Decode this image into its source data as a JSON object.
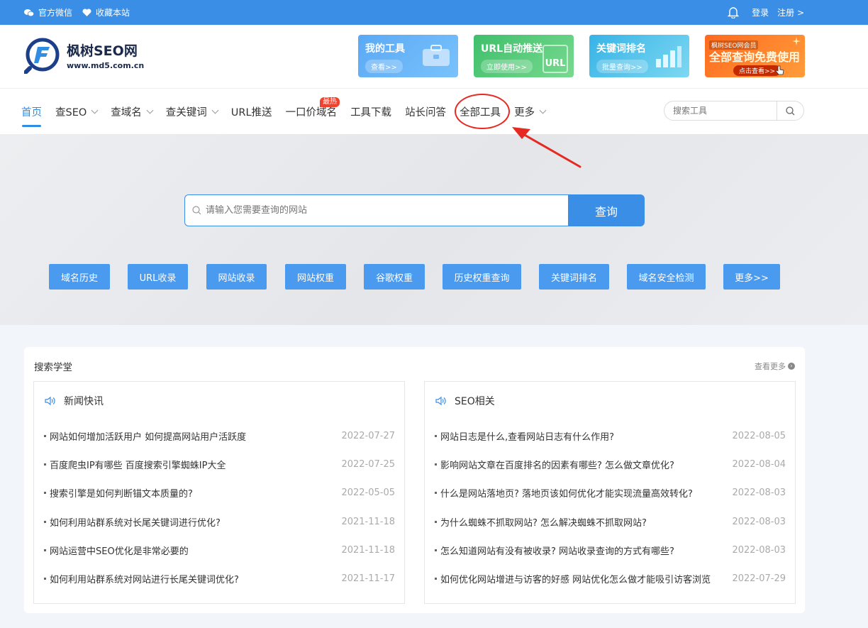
{
  "topbar": {
    "wechat": "官方微信",
    "favorite": "收藏本站",
    "login": "登录",
    "register": "注册 >"
  },
  "logo": {
    "title": "枫树SEO网",
    "url": "www.md5.com.cn"
  },
  "banners": [
    {
      "title": "我的工具",
      "button": "查看>>"
    },
    {
      "title": "URL自动推送",
      "button": "立即使用>>",
      "art": "URL"
    },
    {
      "title": "关键词排名",
      "button": "批量查询>>"
    },
    {
      "top": "枫树SEO网会员",
      "title": "全部查询免费使用",
      "button": "点击查看>>"
    }
  ],
  "nav": {
    "items": [
      {
        "label": "首页",
        "active": true
      },
      {
        "label": "查SEO",
        "dropdown": true
      },
      {
        "label": "查域名",
        "dropdown": true
      },
      {
        "label": "查关键词",
        "dropdown": true
      },
      {
        "label": "URL推送"
      },
      {
        "label": "一口价域名",
        "badge": "最热"
      },
      {
        "label": "工具下载"
      },
      {
        "label": "站长问答"
      },
      {
        "label": "全部工具",
        "highlighted": true
      },
      {
        "label": "更多",
        "dropdown": true
      }
    ],
    "search_placeholder": "搜索工具"
  },
  "hero": {
    "search_placeholder": "请输入您需要查询的网站",
    "search_button": "查询",
    "quick_links": [
      "域名历史",
      "URL收录",
      "网站收录",
      "网站权重",
      "谷歌权重",
      "历史权重查询",
      "关键词排名",
      "域名安全检测",
      "更多>>"
    ]
  },
  "learning": {
    "title": "搜索学堂",
    "more": "查看更多",
    "columns": [
      {
        "heading": "新闻快讯",
        "items": [
          {
            "title": "网站如何增加活跃用户 如何提高网站用户活跃度",
            "date": "2022-07-27"
          },
          {
            "title": "百度爬虫IP有哪些 百度搜索引擎蜘蛛IP大全",
            "date": "2022-07-25"
          },
          {
            "title": "搜索引擎是如何判断锚文本质量的?",
            "date": "2022-05-05"
          },
          {
            "title": "如何利用站群系统对长尾关键词进行优化?",
            "date": "2021-11-18"
          },
          {
            "title": "网站运营中SEO优化是非常必要的",
            "date": "2021-11-18"
          },
          {
            "title": "如何利用站群系统对网站进行长尾关键词优化?",
            "date": "2021-11-17"
          }
        ]
      },
      {
        "heading": "SEO相关",
        "items": [
          {
            "title": "网站日志是什么,查看网站日志有什么作用?",
            "date": "2022-08-05"
          },
          {
            "title": "影响网站文章在百度排名的因素有哪些? 怎么做文章优化?",
            "date": "2022-08-04"
          },
          {
            "title": "什么是网站落地页? 落地页该如何优化才能实现流量高效转化?",
            "date": "2022-08-03"
          },
          {
            "title": "为什么蜘蛛不抓取网站? 怎么解决蜘蛛不抓取网站?",
            "date": "2022-08-03"
          },
          {
            "title": "怎么知道网站有没有被收录? 网站收录查询的方式有哪些?",
            "date": "2022-08-03"
          },
          {
            "title": "如何优化网站增进与访客的好感 网站优化怎么做才能吸引访客浏览",
            "date": "2022-07-29"
          }
        ]
      }
    ]
  },
  "colors": {
    "primary": "#3a8ee6",
    "annotation": "#e52a22",
    "hot_badge": "#f0412c"
  }
}
